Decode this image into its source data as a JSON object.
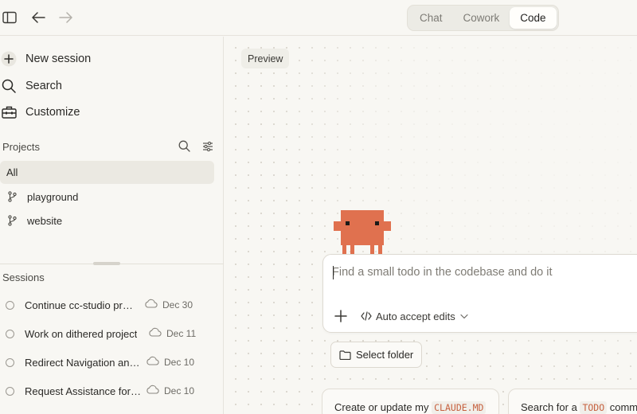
{
  "topbar": {
    "icons": [
      "sidebar-toggle-icon",
      "back-arrow-icon",
      "forward-arrow-icon"
    ],
    "modes": [
      {
        "label": "Chat",
        "active": false
      },
      {
        "label": "Cowork",
        "active": false
      },
      {
        "label": "Code",
        "active": true
      }
    ]
  },
  "sidebar": {
    "nav": [
      {
        "label": "New session",
        "icon": "plus-icon"
      },
      {
        "label": "Search",
        "icon": "search-icon"
      },
      {
        "label": "Customize",
        "icon": "toolbox-icon"
      }
    ],
    "projects_label": "Projects",
    "projects_all": "All",
    "projects": [
      {
        "label": "playground",
        "icon": "branch-icon"
      },
      {
        "label": "website",
        "icon": "branch-icon"
      }
    ],
    "sessions_label": "Sessions",
    "sessions": [
      {
        "title": "Continue cc-studio project",
        "date": "Dec 30"
      },
      {
        "title": "Work on dithered project",
        "date": "Dec 11"
      },
      {
        "title": "Redirect Navigation and Routing",
        "date": "Dec 10"
      },
      {
        "title": "Request Assistance for Task",
        "date": "Dec 10"
      }
    ]
  },
  "main": {
    "preview_label": "Preview",
    "composer": {
      "placeholder": "Find a small todo in the codebase and do it",
      "value": "",
      "accept_label": "Auto accept edits"
    },
    "select_folder_label": "Select folder",
    "suggestions": [
      {
        "prefix": "Create or update my ",
        "code": "CLAUDE.MD",
        "suffix": ""
      },
      {
        "prefix": "Search for a ",
        "code": "TODO",
        "suffix": " comment"
      }
    ]
  },
  "colors": {
    "accent_orange": "#e0714f",
    "background": "#f8f7f3",
    "code_text": "#c6613f"
  }
}
